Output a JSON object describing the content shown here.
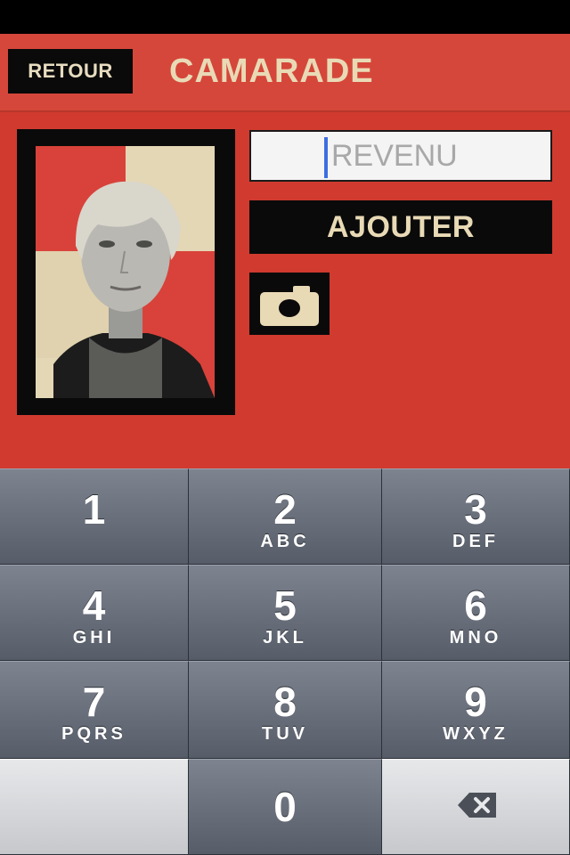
{
  "nav": {
    "back_label": "RETOUR",
    "title": "CAMARADE"
  },
  "form": {
    "income_placeholder": "REVENU",
    "income_value": "",
    "add_label": "AJOUTER",
    "camera_icon": "camera-icon"
  },
  "keypad": {
    "keys": [
      {
        "digit": "1",
        "letters": ""
      },
      {
        "digit": "2",
        "letters": "ABC"
      },
      {
        "digit": "3",
        "letters": "DEF"
      },
      {
        "digit": "4",
        "letters": "GHI"
      },
      {
        "digit": "5",
        "letters": "JKL"
      },
      {
        "digit": "6",
        "letters": "MNO"
      },
      {
        "digit": "7",
        "letters": "PQRS"
      },
      {
        "digit": "8",
        "letters": "TUV"
      },
      {
        "digit": "9",
        "letters": "WXYZ"
      }
    ],
    "zero": "0",
    "delete_icon": "backspace-icon"
  },
  "colors": {
    "accent_red": "#d13a2f",
    "nav_red": "#d5473a",
    "cream": "#e9dab6",
    "black": "#0a0a0a",
    "key_gray": "#6a707c",
    "caret_blue": "#3d6ee0"
  }
}
